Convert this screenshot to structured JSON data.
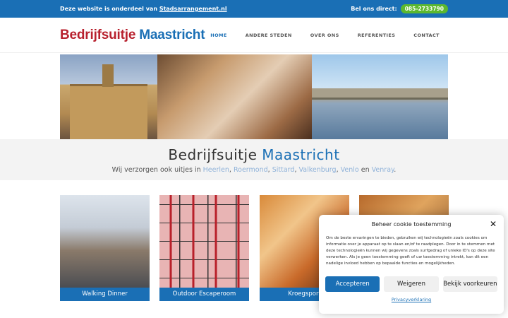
{
  "topbar": {
    "notice": "Deze website is onderdeel van",
    "notice_link": "Stadsarrangement.nl",
    "call_label": "Bel ons direct:",
    "phone": "085-2733790"
  },
  "header": {
    "logo_word1": "Bedrijfsuitje",
    "logo_word2": "Maastricht",
    "nav": [
      "HOME",
      "ANDERE STEDEN",
      "OVER ONS",
      "REFERENTIES",
      "CONTACT"
    ]
  },
  "band": {
    "title_part1": "Bedrijfsuitje",
    "title_part2": "Maastricht",
    "subtitle_prefix": "Wij verzorgen ook uitjes in",
    "cities": [
      "Heerlen",
      "Roermond",
      "Sittard",
      "Valkenburg",
      "Venlo",
      "Venray"
    ],
    "sep": ",",
    "and": "en",
    "end": "."
  },
  "cards": [
    {
      "label": "Walking Dinner"
    },
    {
      "label": "Outdoor Escaperoom"
    },
    {
      "label": "Kroegsport"
    },
    {
      "label": ""
    }
  ],
  "cookie": {
    "title": "Beheer cookie toestemming",
    "body": "Om de beste ervaringen te bieden, gebruiken wij technologieën zoals cookies om informatie over je apparaat op te slaan en/of te raadplegen. Door in te stemmen met deze technologieën kunnen wij gegevens zoals surfgedrag of unieke ID's op deze site verwerken. Als je geen toestemming geeft of uw toestemming intrekt, kan dit een nadelige invloed hebben op bepaalde functies en mogelijkheden.",
    "accept": "Accepteren",
    "deny": "Weigeren",
    "prefs": "Bekijk voorkeuren",
    "policy": "Privacyverklaring"
  },
  "colors": {
    "brand_blue": "#1a6fb5",
    "brand_red": "#b8212e",
    "phone_green": "#5cb82e"
  }
}
